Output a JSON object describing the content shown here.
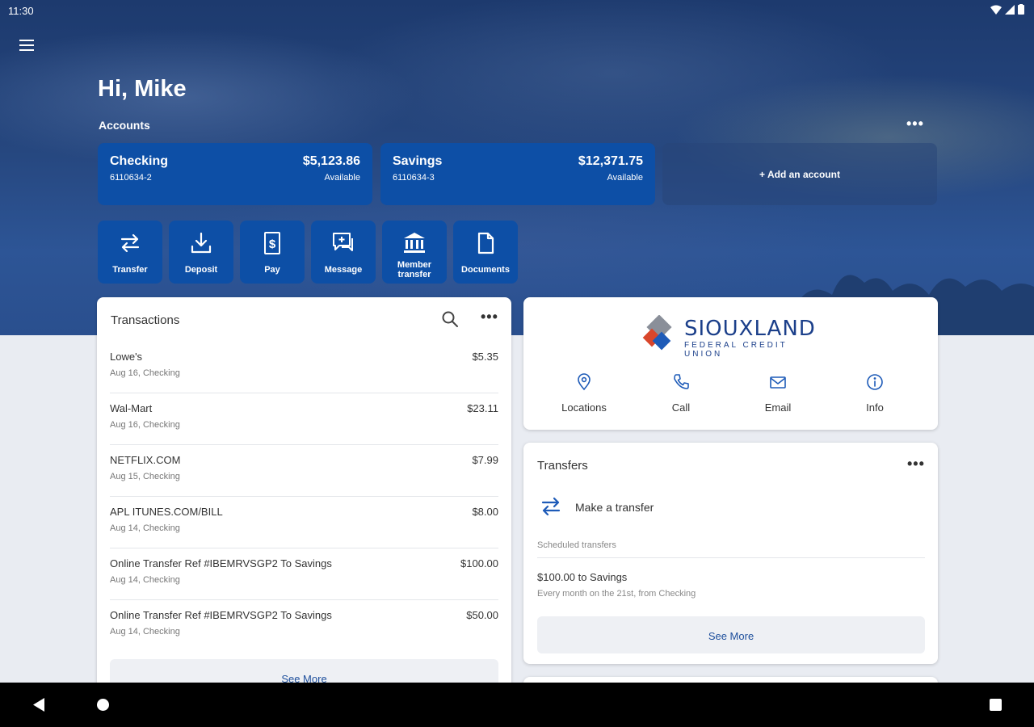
{
  "status_bar": {
    "time": "11:30"
  },
  "greeting": "Hi, Mike",
  "accounts": {
    "label": "Accounts",
    "more_label": "•••",
    "items": [
      {
        "name": "Checking",
        "number": "6110634-2",
        "balance": "$5,123.86",
        "balance_label": "Available"
      },
      {
        "name": "Savings",
        "number": "6110634-3",
        "balance": "$12,371.75",
        "balance_label": "Available"
      }
    ],
    "add_label": "+ Add an account"
  },
  "actions": [
    {
      "label": "Transfer",
      "icon": "transfer-icon"
    },
    {
      "label": "Deposit",
      "icon": "deposit-icon"
    },
    {
      "label": "Pay",
      "icon": "pay-icon"
    },
    {
      "label": "Message",
      "icon": "message-icon"
    },
    {
      "label": "Member transfer",
      "line1": "Member",
      "line2": "transfer",
      "icon": "bank-icon"
    },
    {
      "label": "Documents",
      "icon": "document-icon"
    }
  ],
  "transactions": {
    "title": "Transactions",
    "more_label": "•••",
    "see_more": "See More",
    "rows": [
      {
        "desc": "Lowe's",
        "meta": "Aug 16, Checking",
        "amount": "$5.35"
      },
      {
        "desc": "Wal-Mart",
        "meta": "Aug 16, Checking",
        "amount": "$23.11"
      },
      {
        "desc": "NETFLIX.COM",
        "meta": "Aug 15, Checking",
        "amount": "$7.99"
      },
      {
        "desc": "APL ITUNES.COM/BILL",
        "meta": "Aug 14, Checking",
        "amount": "$8.00"
      },
      {
        "desc": "Online Transfer Ref #IBEMRVSGP2 To Savings",
        "meta": "Aug 14, Checking",
        "amount": "$100.00"
      },
      {
        "desc": "Online Transfer Ref #IBEMRVSGP2 To Savings",
        "meta": "Aug 14, Checking",
        "amount": "$50.00"
      }
    ]
  },
  "credit_union": {
    "logo_main": "SIOUXLAND",
    "logo_sub": "FEDERAL CREDIT UNION",
    "links": [
      {
        "label": "Locations",
        "icon": "location-pin-icon"
      },
      {
        "label": "Call",
        "icon": "phone-icon"
      },
      {
        "label": "Email",
        "icon": "email-icon"
      },
      {
        "label": "Info",
        "icon": "info-icon"
      }
    ]
  },
  "transfers": {
    "title": "Transfers",
    "more_label": "•••",
    "make_transfer": "Make a transfer",
    "scheduled_label": "Scheduled transfers",
    "scheduled": [
      {
        "title": "$100.00 to Savings",
        "subtitle": "Every month on the 21st, from Checking"
      }
    ],
    "see_more": "See More"
  },
  "colors": {
    "accent_blue": "#0d4fa6",
    "link_blue": "#1e4f9c",
    "background": "#e9ecf2"
  }
}
